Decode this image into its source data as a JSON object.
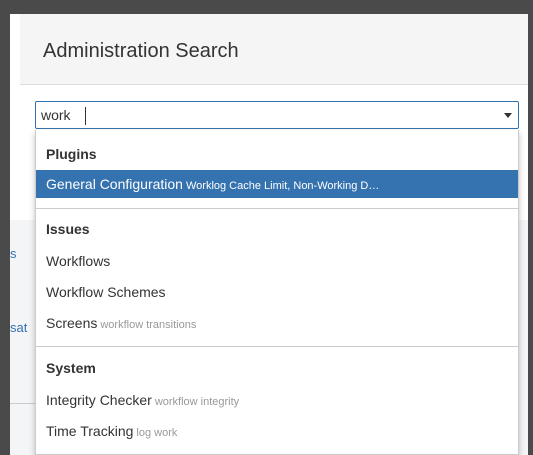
{
  "dialog": {
    "title": "Administration Search"
  },
  "search": {
    "value": "work"
  },
  "background": {
    "left_fragment_1": "s",
    "left_fragment_2": "sat"
  },
  "results": {
    "groups": [
      {
        "heading": "Plugins",
        "items": [
          {
            "label": "General Configuration",
            "description": "Worklog Cache Limit, Non-Working D…",
            "active": true
          }
        ]
      },
      {
        "heading": "Issues",
        "items": [
          {
            "label": "Workflows",
            "description": ""
          },
          {
            "label": "Workflow Schemes",
            "description": ""
          },
          {
            "label": "Screens",
            "description": "workflow transitions"
          }
        ]
      },
      {
        "heading": "System",
        "items": [
          {
            "label": "Integrity Checker",
            "description": "workflow integrity"
          },
          {
            "label": "Time Tracking",
            "description": "log work"
          }
        ]
      }
    ]
  },
  "icons": {
    "dropdown": "chevron-down-icon"
  },
  "colors": {
    "accent": "#3572b0",
    "overlay": "#4a4a4a",
    "text": "#333333",
    "muted": "#999999"
  }
}
